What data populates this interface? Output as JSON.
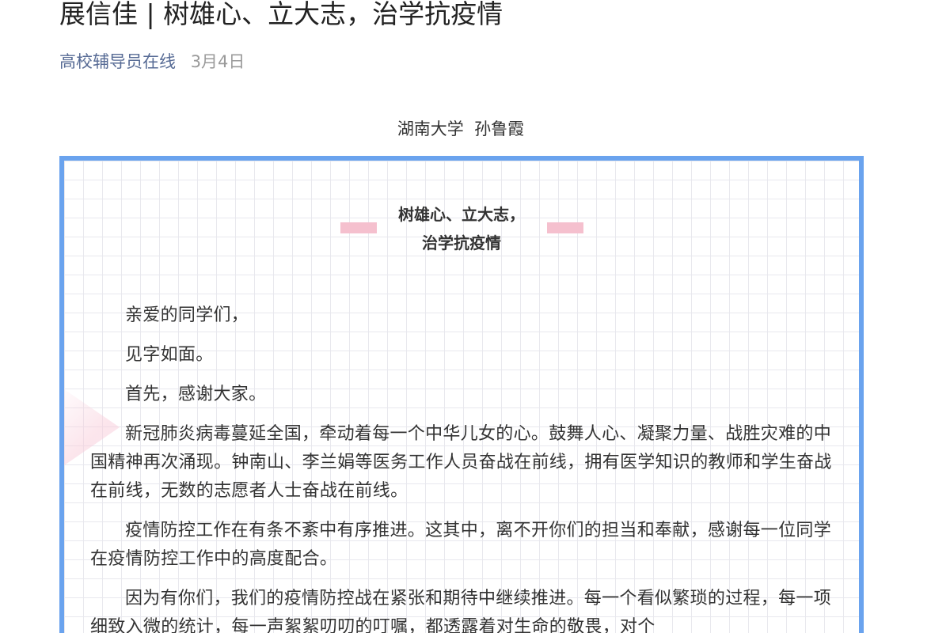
{
  "article": {
    "title": "展信佳 | 树雄心、立大志，治学抗疫情",
    "account": "高校辅导员在线",
    "date": "3月4日",
    "author_line": "湖南大学  孙鲁霞"
  },
  "letter": {
    "heading_line1": "树雄心、立大志，",
    "heading_line2": "治学抗疫情",
    "paragraphs": [
      "亲爱的同学们，",
      "见字如面。",
      "首先，感谢大家。",
      "新冠肺炎病毒蔓延全国，牵动着每一个中华儿女的心。鼓舞人心、凝聚力量、战胜灾难的中国精神再次涌现。钟南山、李兰娟等医务工作人员奋战在前线，拥有医学知识的教师和学生奋战在前线，无数的志愿者人士奋战在前线。",
      "疫情防控工作在有条不紊中有序推进。这其中，离不开你们的担当和奉献，感谢每一位同学在疫情防控工作中的高度配合。",
      "因为有你们，我们的疫情防控战在紧张和期待中继续推进。每一个看似繁琐的过程，每一项细致入微的统计，每一声絮絮叨叨的叮嘱，都透露着对生命的敬畏，对个"
    ]
  },
  "colors": {
    "account_link": "#576b95",
    "frame_border": "#6aa3ee",
    "pink_accent": "#f5c0ce"
  }
}
